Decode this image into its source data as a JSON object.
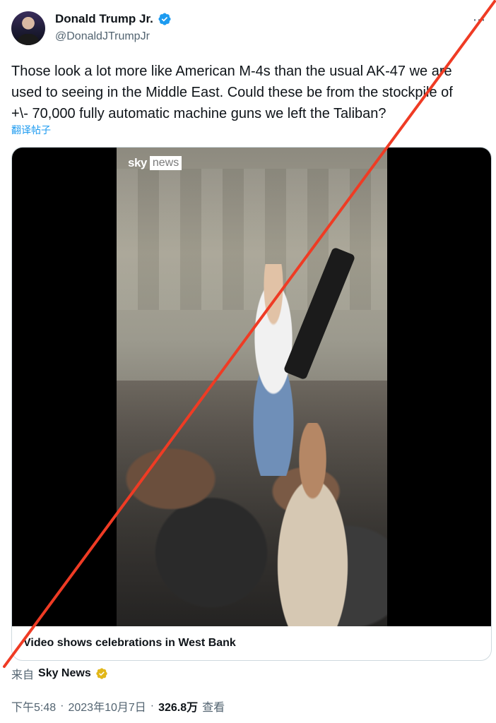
{
  "author": {
    "display_name": "Donald Trump Jr.",
    "handle": "@DonaldJTrumpJr"
  },
  "more_icon": "⋯",
  "tweet": {
    "lines": [
      "Those look a lot more like American M-4s than the usual AK-47 we are",
      "used to seeing in the Middle East. Could these be from the stockpile of",
      "+\\- 70,000 fully automatic machine guns we left the Taliban?"
    ],
    "translate_label": "翻译帖子"
  },
  "media": {
    "logo_sky": "sky",
    "logo_news": "news",
    "caption": "Video shows celebrations in West Bank"
  },
  "source": {
    "prefix": "来自",
    "name": "Sky News"
  },
  "meta": {
    "time": "下午5:48",
    "separator1": "·",
    "date": "2023年10月7日",
    "separator2": "·",
    "views": "326.8万",
    "views_label": "查看"
  },
  "colors": {
    "verified_blue": "#1d9bf0",
    "gold_badge": "#e2b719",
    "cross_line": "#ef3b24"
  },
  "icons": {
    "verified": "verified-badge-icon",
    "gold": "gold-verified-badge-icon",
    "more": "more-icon"
  }
}
